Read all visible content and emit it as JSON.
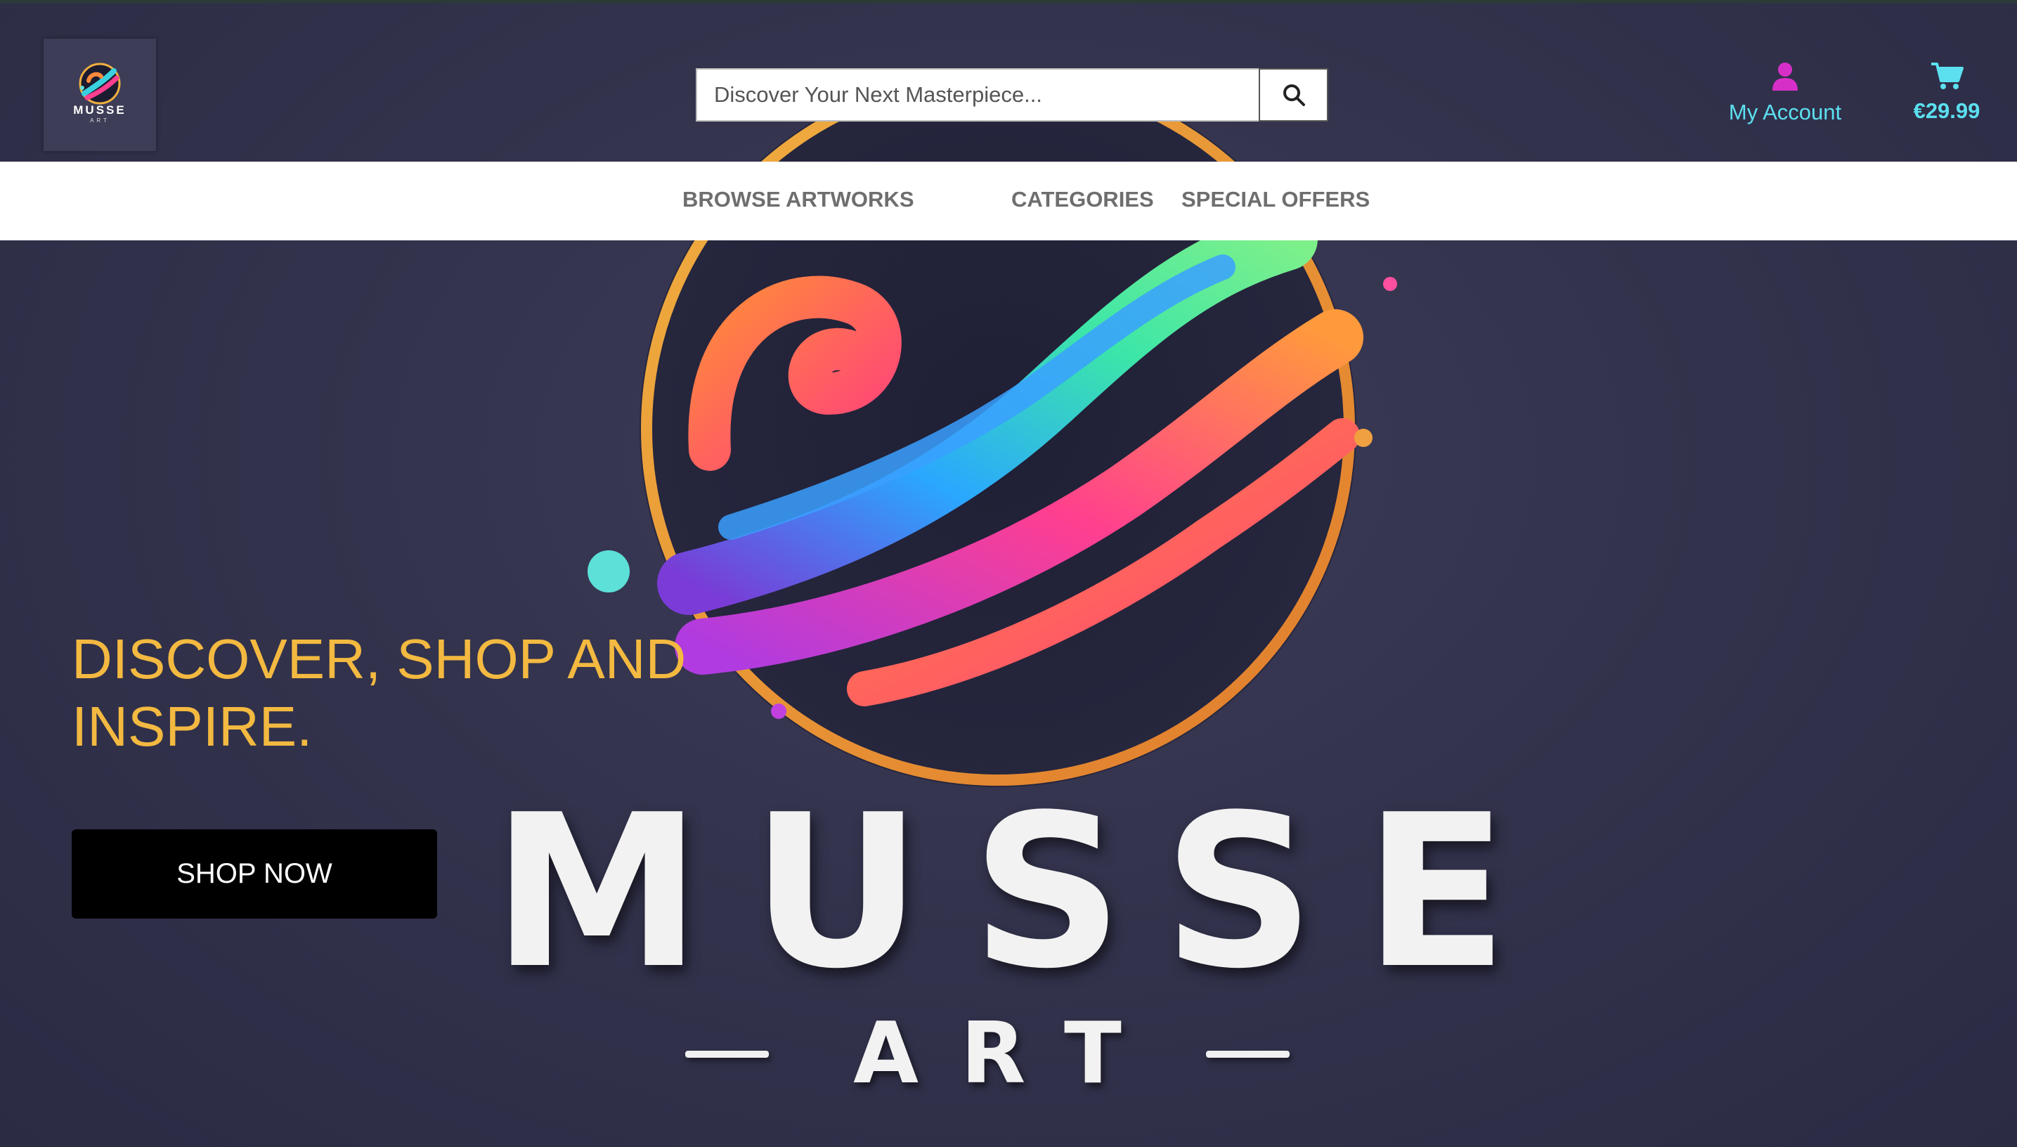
{
  "header": {
    "logo": {
      "text": "MUSSE",
      "subtext": "ART"
    },
    "search": {
      "placeholder": "Discover Your Next Masterpiece...",
      "value": "",
      "icon": "search-icon"
    },
    "account": {
      "label": "My Account",
      "icon": "user-icon",
      "icon_color": "#d62fc8"
    },
    "cart": {
      "total": "€29.99",
      "icon": "cart-icon",
      "icon_color": "#5ce0f0"
    }
  },
  "nav": {
    "items": [
      {
        "label": "BROWSE ARTWORKS"
      },
      {
        "label": "CATEGORIES"
      },
      {
        "label": "SPECIAL OFFERS"
      }
    ]
  },
  "hero": {
    "headline_lines": [
      "DISCOVER, SHOP AND",
      "INSPIRE."
    ],
    "cta_label": "SHOP NOW",
    "brand_word": "MUSSE",
    "brand_sub": "ART"
  },
  "colors": {
    "accent": "#5ce0f0",
    "headline": "#f3b940",
    "user_icon": "#d62fc8",
    "background": "#33334d"
  }
}
